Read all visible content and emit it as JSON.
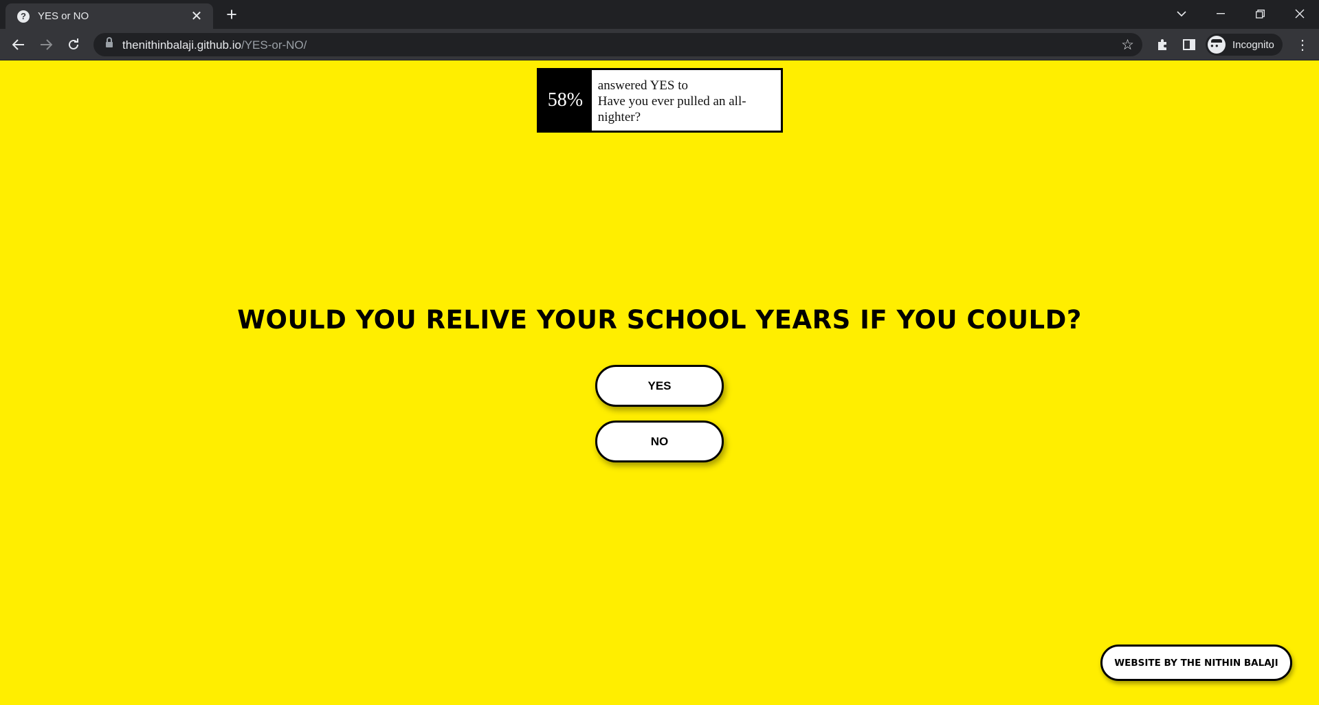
{
  "browser": {
    "tab_title": "YES or NO",
    "tab_favicon": "question-icon",
    "url_host": "thenithinbalaji.github.io",
    "url_path": "/YES-or-NO/",
    "profile_label": "Incognito"
  },
  "stat": {
    "percent": "58%",
    "line1": "answered YES to",
    "question": "Have you ever pulled an all-nighter?"
  },
  "main": {
    "question": "WOULD YOU RELIVE YOUR SCHOOL YEARS IF YOU COULD?",
    "yes_label": "YES",
    "no_label": "NO"
  },
  "footer": {
    "credit_label": "WEBSITE BY THE NITHIN BALAJI"
  },
  "colors": {
    "page_background": "#ffee00",
    "button_background": "#ffffff",
    "border": "#000000",
    "chrome_dark": "#202124",
    "chrome_toolbar": "#35363a"
  }
}
